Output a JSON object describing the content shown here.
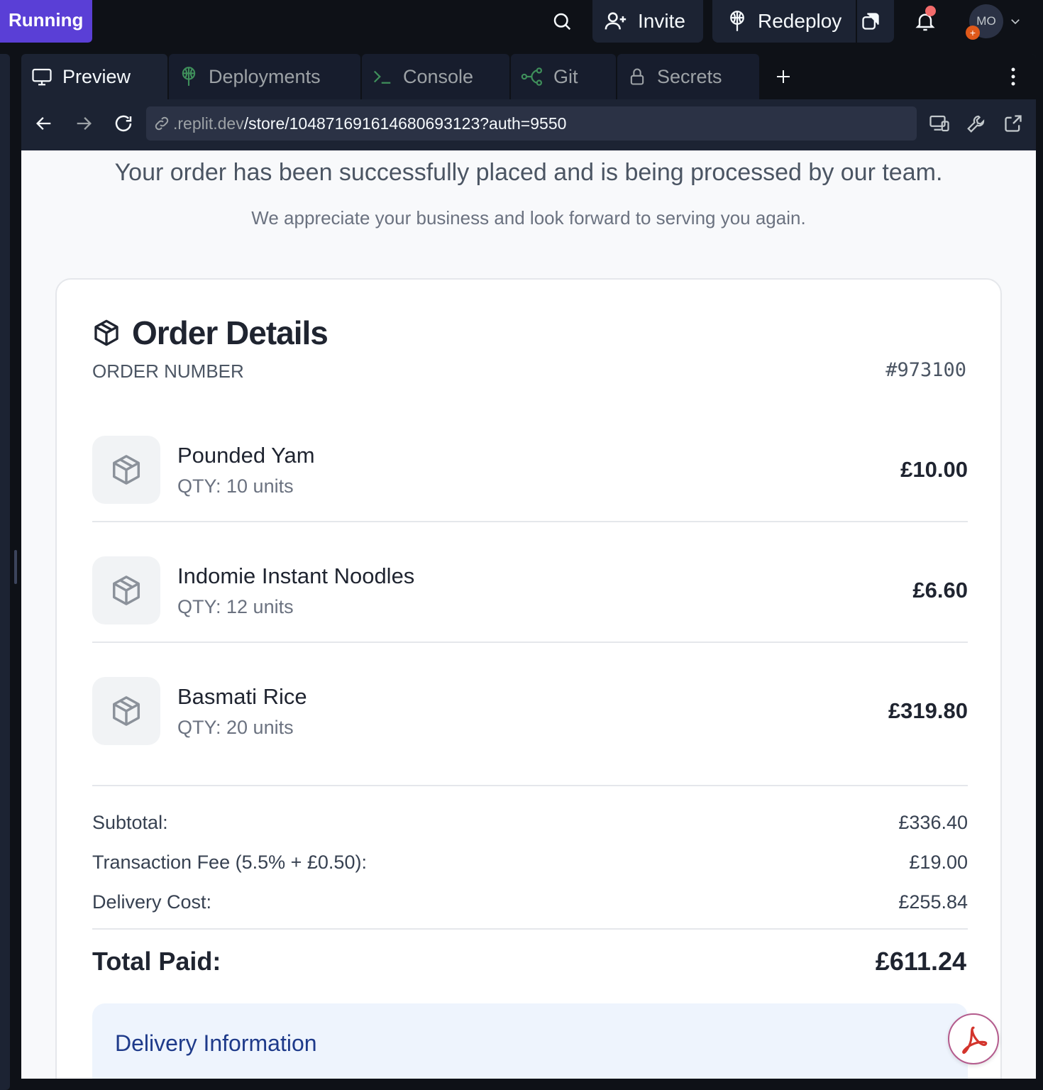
{
  "topbar": {
    "status": "Running",
    "invite_label": "Invite",
    "redeploy_label": "Redeploy",
    "avatar_initials": "MO",
    "avatar_badge": "+"
  },
  "tabs": [
    {
      "label": "Preview",
      "icon": "monitor-icon"
    },
    {
      "label": "Deployments",
      "icon": "deployments-icon"
    },
    {
      "label": "Console",
      "icon": "terminal-icon"
    },
    {
      "label": "Git",
      "icon": "git-icon"
    },
    {
      "label": "Secrets",
      "icon": "lock-icon"
    }
  ],
  "urlbar": {
    "domain": ".replit.dev",
    "path": "/store/10487169161468069312​3?auth=9550"
  },
  "page": {
    "message": "Your order has been successfully placed and is being processed by our team.",
    "submessage": "We appreciate your business and look forward to serving you again."
  },
  "order": {
    "title": "Order Details",
    "number_label": "ORDER NUMBER",
    "number": "#973100",
    "items": [
      {
        "name": "Pounded Yam",
        "qty": "QTY: 10 units",
        "price": "£10.00"
      },
      {
        "name": "Indomie Instant Noodles",
        "qty": "QTY: 12 units",
        "price": "£6.60"
      },
      {
        "name": "Basmati Rice",
        "qty": "QTY: 20 units",
        "price": "£319.80"
      }
    ],
    "summary": [
      {
        "label": "Subtotal:",
        "value": "£336.40"
      },
      {
        "label": "Transaction Fee (5.5% + £0.50):",
        "value": "£19.00"
      },
      {
        "label": "Delivery Cost:",
        "value": "£255.84"
      }
    ],
    "total_label": "Total Paid:",
    "total_value": "£611.24"
  },
  "delivery": {
    "title": "Delivery Information"
  },
  "colors": {
    "status_bg": "#5a3fd6",
    "delivery_title": "#1e3a8a",
    "pdf_red": "#d3342c"
  }
}
